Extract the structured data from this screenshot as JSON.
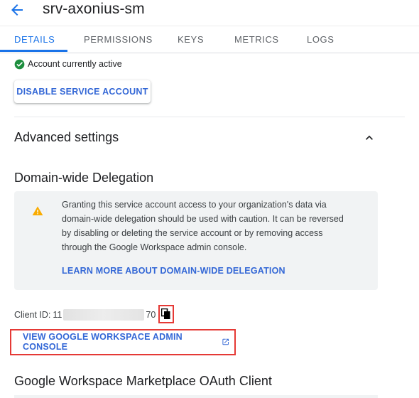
{
  "header": {
    "title": "srv-axonius-sm"
  },
  "tabs": [
    {
      "label": "DETAILS",
      "active": true
    },
    {
      "label": "PERMISSIONS",
      "active": false
    },
    {
      "label": "KEYS",
      "active": false
    },
    {
      "label": "METRICS",
      "active": false
    },
    {
      "label": "LOGS",
      "active": false
    }
  ],
  "status": {
    "text": "Account currently active",
    "icon": "check-circle-icon",
    "color": "#1e8e3e"
  },
  "disable_button": {
    "label": "DISABLE SERVICE ACCOUNT"
  },
  "advanced": {
    "title": "Advanced settings",
    "expanded": true
  },
  "delegation": {
    "title": "Domain-wide Delegation",
    "warning_icon": "warning-icon",
    "warning_lines": [
      "Granting this service account access to your organization's data via",
      "domain-wide delegation should be used with caution. It can be reversed",
      "by disabling or deleting the service account or by removing access",
      "through the Google Workspace admin console."
    ],
    "learn_more": "LEARN MORE ABOUT DOMAIN-WIDE DELEGATION"
  },
  "client": {
    "label": "Client ID:",
    "prefix": "11",
    "suffix": "70",
    "copy_icon": "copy-icon"
  },
  "console_link": {
    "label": "VIEW GOOGLE WORKSPACE ADMIN CONSOLE",
    "icon": "open-in-new-icon"
  },
  "oauth": {
    "title": "Google Workspace Marketplace OAuth Client"
  },
  "colors": {
    "accent": "#1a73e8",
    "link": "#3367d6",
    "highlight": "#e53935",
    "warning": "#f9ab00"
  }
}
